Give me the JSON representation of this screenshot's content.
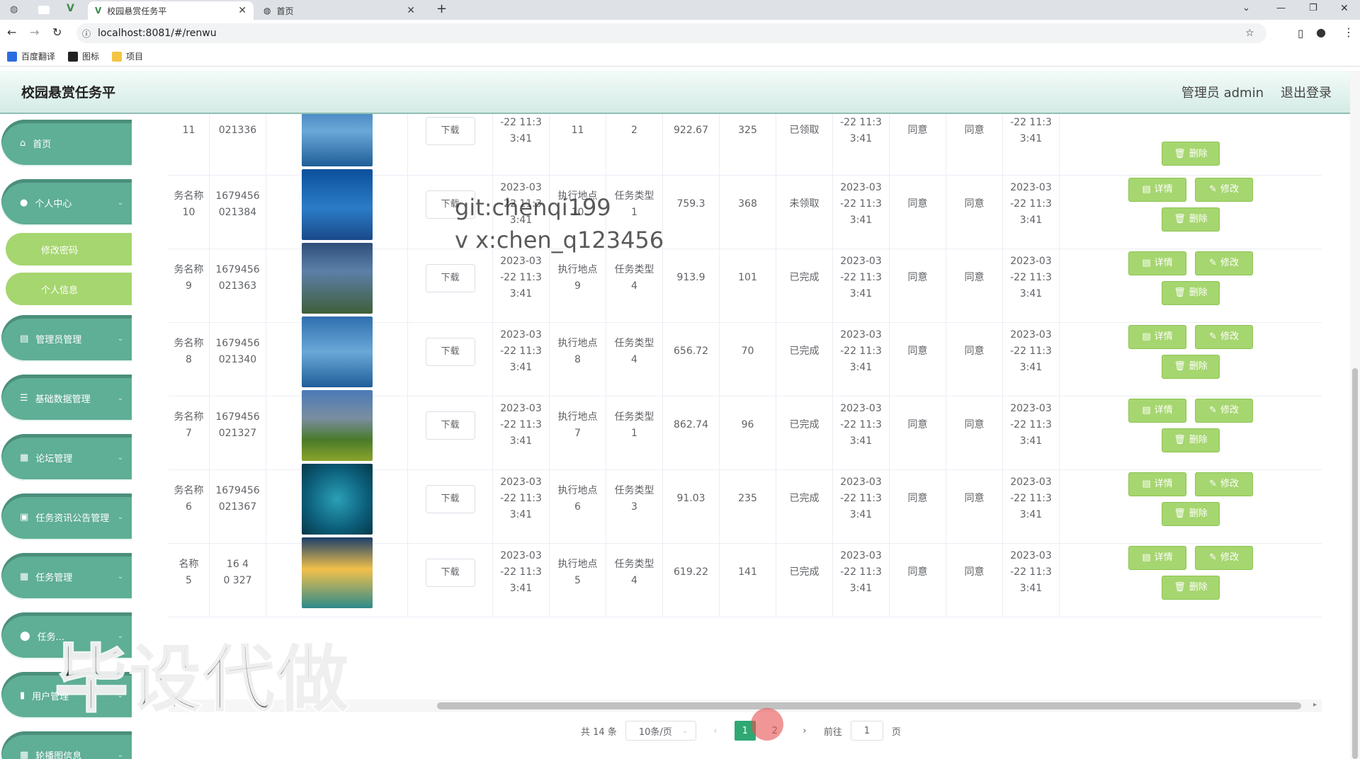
{
  "browser": {
    "tabs": [
      {
        "title": "校园悬赏任务平"
      },
      {
        "title": "首页"
      }
    ],
    "url": "localhost:8081/#/renwu",
    "bookmarks": [
      "百度翻译",
      "图标",
      "项目"
    ]
  },
  "header": {
    "title": "校园悬赏任务平",
    "user": "管理员 admin",
    "logout": "退出登录"
  },
  "sidebar": {
    "items": [
      {
        "label": "首页",
        "icon": "home-icon"
      },
      {
        "label": "个人中心",
        "icon": "user-icon"
      },
      {
        "label": "修改密码"
      },
      {
        "label": "个人信息"
      },
      {
        "label": "管理员管理",
        "icon": "chat-icon"
      },
      {
        "label": "基础数据管理",
        "icon": "list-icon"
      },
      {
        "label": "论坛管理",
        "icon": "grid-icon"
      },
      {
        "label": "任务资讯公告管理",
        "icon": "doc-icon"
      },
      {
        "label": "任务管理",
        "icon": "grid-icon"
      },
      {
        "label": "任务...",
        "icon": "pin-icon"
      },
      {
        "label": "用户管理",
        "icon": "chart-icon"
      },
      {
        "label": "轮播图信息",
        "icon": "grid-icon"
      }
    ]
  },
  "table": {
    "download_label": "下载",
    "details_label": "详情",
    "edit_label": "修改",
    "delete_label": "删除",
    "rows": [
      {
        "name": "11",
        "id": "021336",
        "time": "-22 11:3\n3:41",
        "place": "11",
        "type": "2",
        "price": "922.67",
        "count": "325",
        "status": "已领取",
        "time2": "-22 11:3\n3:41",
        "a1": "同意",
        "a2": "同意",
        "time3": "-22 11:3\n3:41",
        "img": "lake"
      },
      {
        "name": "务名称\n10",
        "id": "1679456\n021384",
        "time": "2023-03\n-22 11:3\n3:41",
        "place": "执行地点\n10",
        "type": "任务类型\n1",
        "price": "759.3",
        "count": "368",
        "status": "未领取",
        "time2": "2023-03\n-22 11:3\n3:41",
        "a1": "同意",
        "a2": "同意",
        "time3": "2023-03\n-22 11:3\n3:41",
        "img": "sea"
      },
      {
        "name": "务名称\n9",
        "id": "1679456\n021363",
        "time": "2023-03\n-22 11:3\n3:41",
        "place": "执行地点\n9",
        "type": "任务类型\n4",
        "price": "913.9",
        "count": "101",
        "status": "已完成",
        "time2": "2023-03\n-22 11:3\n3:41",
        "a1": "同意",
        "a2": "同意",
        "time3": "2023-03\n-22 11:3\n3:41",
        "img": "river"
      },
      {
        "name": "务名称\n8",
        "id": "1679456\n021340",
        "time": "2023-03\n-22 11:3\n3:41",
        "place": "执行地点\n8",
        "type": "任务类型\n4",
        "price": "656.72",
        "count": "70",
        "status": "已完成",
        "time2": "2023-03\n-22 11:3\n3:41",
        "a1": "同意",
        "a2": "同意",
        "time3": "2023-03\n-22 11:3\n3:41",
        "img": "lake"
      },
      {
        "name": "务名称\n7",
        "id": "1679456\n021327",
        "time": "2023-03\n-22 11:3\n3:41",
        "place": "执行地点\n7",
        "type": "任务类型\n1",
        "price": "862.74",
        "count": "96",
        "status": "已完成",
        "time2": "2023-03\n-22 11:3\n3:41",
        "a1": "同意",
        "a2": "同意",
        "time3": "2023-03\n-22 11:3\n3:41",
        "img": "mountain"
      },
      {
        "name": "务名称\n6",
        "id": "1679456\n021367",
        "time": "2023-03\n-22 11:3\n3:41",
        "place": "执行地点\n6",
        "type": "任务类型\n3",
        "price": "91.03",
        "count": "235",
        "status": "已完成",
        "time2": "2023-03\n-22 11:3\n3:41",
        "a1": "同意",
        "a2": "同意",
        "time3": "2023-03\n-22 11:3\n3:41",
        "img": "heart"
      },
      {
        "name": "名称\n5",
        "id": "16 4\n0 327",
        "time": "2023-03\n-22 11:3\n3:41",
        "place": "执行地点\n5",
        "type": "任务类型\n4",
        "price": "619.22",
        "count": "141",
        "status": "已完成",
        "time2": "2023-03\n-22 11:3\n3:41",
        "a1": "同意",
        "a2": "同意",
        "time3": "2023-03\n-22 11:3\n3:41",
        "img": "sunset"
      }
    ]
  },
  "pagination": {
    "total": "共 14 条",
    "page_size": "10条/页",
    "pages": [
      "1",
      "2"
    ],
    "current": "1",
    "goto_label": "前往",
    "goto_value": "1",
    "page_suffix": "页"
  },
  "overlays": {
    "watermark_text": "git:chenqi199\nv x:chen_q123456",
    "big_watermark": "毕设代做"
  },
  "colors": {
    "sidebar": "#5fae96",
    "button": "#a6d66f",
    "pager_active": "#2fa874"
  }
}
